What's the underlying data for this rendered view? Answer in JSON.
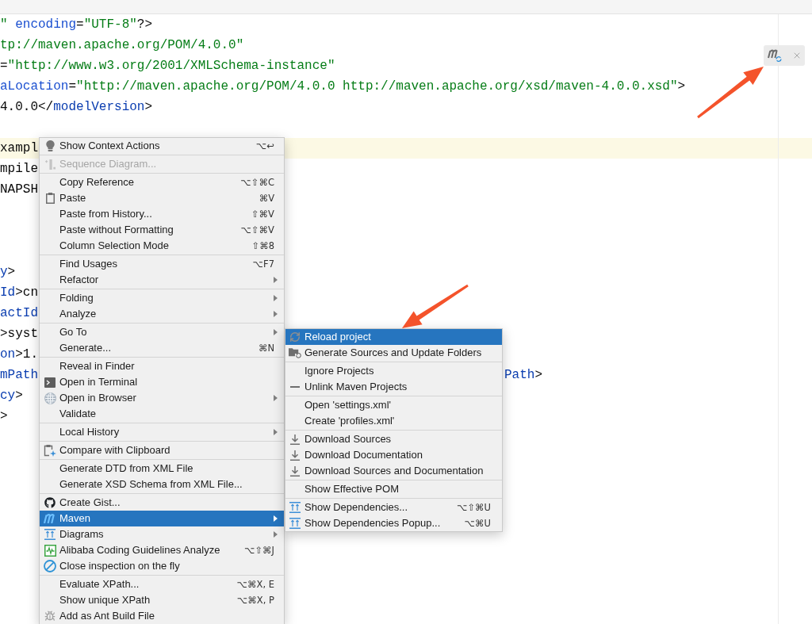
{
  "editor": {
    "lines": [
      {
        "current": false,
        "tokens": [
          {
            "text": "\"",
            "kind": "value"
          },
          {
            "text": " encoding",
            "kind": "attr"
          },
          {
            "text": "=",
            "kind": "text"
          },
          {
            "text": "\"UTF-8\"",
            "kind": "value"
          },
          {
            "text": "?>",
            "kind": "text"
          }
        ]
      },
      {
        "current": false,
        "tokens": [
          {
            "text": "tp://maven.apache.org/POM/4.0.0\"",
            "kind": "value"
          }
        ]
      },
      {
        "current": false,
        "tokens": [
          {
            "text": "=",
            "kind": "text"
          },
          {
            "text": "\"http://www.w3.org/2001/XMLSchema-instance\"",
            "kind": "value"
          }
        ]
      },
      {
        "current": false,
        "tokens": [
          {
            "text": "aLocation",
            "kind": "attr"
          },
          {
            "text": "=",
            "kind": "text"
          },
          {
            "text": "\"http://maven.apache.org/POM/4.0.0 http://maven.apache.org/xsd/maven-4.0.0.xsd\"",
            "kind": "value"
          },
          {
            "text": ">",
            "kind": "text"
          }
        ]
      },
      {
        "current": false,
        "tokens": [
          {
            "text": "4.0.0</",
            "kind": "text"
          },
          {
            "text": "modelVersion",
            "kind": "tag"
          },
          {
            "text": ">",
            "kind": "text"
          }
        ]
      },
      {
        "current": false
      },
      {
        "current": true,
        "tokens": [
          {
            "text": "xampl",
            "kind": "text"
          }
        ]
      },
      {
        "current": false,
        "tokens": [
          {
            "text": "mpile",
            "kind": "text"
          }
        ]
      },
      {
        "current": false,
        "tokens": [
          {
            "text": "NAPSH",
            "kind": "text"
          }
        ]
      },
      {
        "current": false
      },
      {
        "current": false
      },
      {
        "current": false
      },
      {
        "current": false,
        "tokens": [
          {
            "text": "y",
            "kind": "tag"
          },
          {
            "text": ">",
            "kind": "text"
          }
        ]
      },
      {
        "current": false,
        "tokens": [
          {
            "text": "Id",
            "kind": "tag"
          },
          {
            "text": ">cn",
            "kind": "text"
          }
        ]
      },
      {
        "current": false,
        "tokens": [
          {
            "text": "actId",
            "kind": "tag"
          }
        ]
      },
      {
        "current": false,
        "tokens": [
          {
            "text": ">syst",
            "kind": "text"
          }
        ]
      },
      {
        "current": false,
        "tokens": [
          {
            "text": "on",
            "kind": "tag"
          },
          {
            "text": ">1.",
            "kind": "text"
          }
        ]
      },
      {
        "current": false,
        "tokens": [
          {
            "text": "mPath",
            "kind": "tag"
          }
        ],
        "after_popup": [
          {
            "text": "Path",
            "kind": "tag"
          },
          {
            "text": ">",
            "kind": "text"
          }
        ]
      },
      {
        "current": false,
        "tokens": [
          {
            "text": "cy",
            "kind": "tag"
          },
          {
            "text": ">",
            "kind": "text"
          }
        ]
      },
      {
        "current": false,
        "tokens": [
          {
            "text": ">",
            "kind": "text"
          }
        ]
      }
    ]
  },
  "context_menu": {
    "groups": [
      {
        "items": [
          {
            "label": "Show Context Actions",
            "shortcut": "⌥↩",
            "selected": false,
            "disabled": false,
            "submenu": false
          }
        ]
      },
      {
        "items": [
          {
            "label": "Sequence Diagram...",
            "selected": false,
            "disabled": true,
            "submenu": false
          }
        ]
      },
      {
        "items": [
          {
            "label": "Copy Reference",
            "shortcut": "⌥⇧⌘C",
            "selected": false,
            "disabled": false,
            "submenu": false
          },
          {
            "label": "Paste",
            "shortcut": "⌘V",
            "selected": false,
            "disabled": false,
            "submenu": false
          },
          {
            "label": "Paste from History...",
            "shortcut": "⇧⌘V",
            "selected": false,
            "disabled": false,
            "submenu": false
          },
          {
            "label": "Paste without Formatting",
            "shortcut": "⌥⇧⌘V",
            "selected": false,
            "disabled": false,
            "submenu": false
          },
          {
            "label": "Column Selection Mode",
            "shortcut": "⇧⌘8",
            "selected": false,
            "disabled": false,
            "submenu": false
          }
        ]
      },
      {
        "items": [
          {
            "label": "Find Usages",
            "shortcut": "⌥F7",
            "selected": false,
            "disabled": false,
            "submenu": false
          },
          {
            "label": "Refactor",
            "selected": false,
            "disabled": false,
            "submenu": true
          }
        ]
      },
      {
        "items": [
          {
            "label": "Folding",
            "selected": false,
            "disabled": false,
            "submenu": true
          },
          {
            "label": "Analyze",
            "selected": false,
            "disabled": false,
            "submenu": true
          }
        ]
      },
      {
        "items": [
          {
            "label": "Go To",
            "selected": false,
            "disabled": false,
            "submenu": true
          },
          {
            "label": "Generate...",
            "shortcut": "⌘N",
            "selected": false,
            "disabled": false,
            "submenu": false
          }
        ]
      },
      {
        "items": [
          {
            "label": "Reveal in Finder",
            "selected": false,
            "disabled": false,
            "submenu": false
          },
          {
            "label": "Open in Terminal",
            "selected": false,
            "disabled": false,
            "submenu": false
          },
          {
            "label": "Open in Browser",
            "selected": false,
            "disabled": false,
            "submenu": true
          },
          {
            "label": "Validate",
            "selected": false,
            "disabled": false,
            "submenu": false
          }
        ]
      },
      {
        "items": [
          {
            "label": "Local History",
            "selected": false,
            "disabled": false,
            "submenu": true
          }
        ]
      },
      {
        "items": [
          {
            "label": "Compare with Clipboard",
            "selected": false,
            "disabled": false,
            "submenu": false
          }
        ]
      },
      {
        "items": [
          {
            "label": "Generate DTD from XML File",
            "selected": false,
            "disabled": false,
            "submenu": false
          },
          {
            "label": "Generate XSD Schema from XML File...",
            "selected": false,
            "disabled": false,
            "submenu": false
          }
        ]
      },
      {
        "items": [
          {
            "label": "Create Gist...",
            "selected": false,
            "disabled": false,
            "submenu": false
          },
          {
            "label": "Maven",
            "selected": true,
            "disabled": false,
            "submenu": true
          },
          {
            "label": "Diagrams",
            "selected": false,
            "disabled": false,
            "submenu": true
          },
          {
            "label": "Alibaba Coding Guidelines Analyze",
            "shortcut": "⌥⇧⌘J",
            "selected": false,
            "disabled": false,
            "submenu": false
          },
          {
            "label": "Close inspection on the fly",
            "selected": false,
            "disabled": false,
            "submenu": false
          }
        ]
      },
      {
        "items": [
          {
            "label": "Evaluate XPath...",
            "shortcut": "⌥⌘X, E",
            "selected": false,
            "disabled": false,
            "submenu": false
          },
          {
            "label": "Show unique XPath",
            "shortcut": "⌥⌘X, P",
            "selected": false,
            "disabled": false,
            "submenu": false
          },
          {
            "label": "Add as Ant Build File",
            "selected": false,
            "disabled": false,
            "submenu": false
          }
        ]
      }
    ]
  },
  "maven_submenu": {
    "groups": [
      {
        "items": [
          {
            "label": "Reload project",
            "selected": true
          },
          {
            "label": "Generate Sources and Update Folders",
            "selected": false
          }
        ]
      },
      {
        "items": [
          {
            "label": "Ignore Projects",
            "selected": false
          },
          {
            "label": "Unlink Maven Projects",
            "selected": false
          }
        ]
      },
      {
        "items": [
          {
            "label": "Open 'settings.xml'",
            "selected": false
          },
          {
            "label": "Create 'profiles.xml'",
            "selected": false
          }
        ]
      },
      {
        "items": [
          {
            "label": "Download Sources",
            "selected": false
          },
          {
            "label": "Download Documentation",
            "selected": false
          },
          {
            "label": "Download Sources and Documentation",
            "selected": false
          }
        ]
      },
      {
        "items": [
          {
            "label": "Show Effective POM",
            "selected": false
          }
        ]
      },
      {
        "items": [
          {
            "label": "Show Dependencies...",
            "shortcut": "⌥⇧⌘U",
            "selected": false
          },
          {
            "label": "Show Dependencies Popup...",
            "shortcut": "⌥⌘U",
            "selected": false
          }
        ]
      }
    ]
  }
}
